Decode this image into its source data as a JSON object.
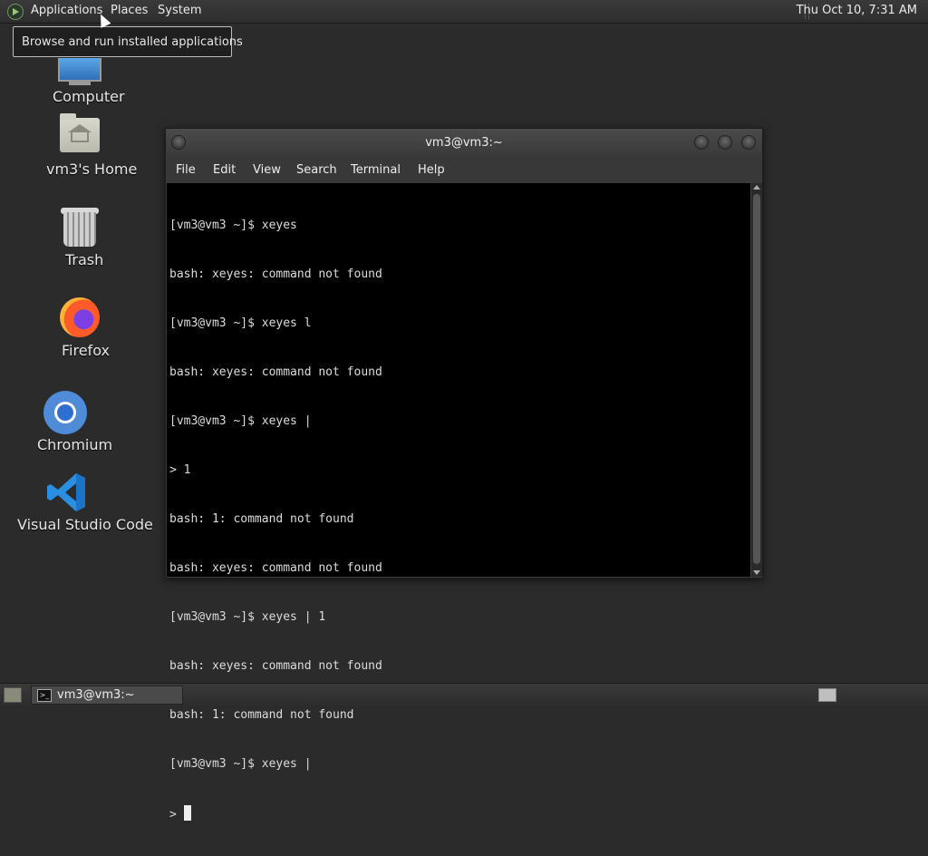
{
  "top_panel": {
    "menus": [
      "Applications",
      "Places",
      "System"
    ],
    "clock": "Thu Oct 10,  7:31 AM"
  },
  "tooltip": {
    "text": "Browse and run installed applications"
  },
  "desktop": {
    "icons": [
      {
        "label": "Computer",
        "icon": "computer-icon"
      },
      {
        "label": "vm3's Home",
        "icon": "home-folder-icon"
      },
      {
        "label": "Trash",
        "icon": "trash-icon"
      },
      {
        "label": "Firefox",
        "icon": "firefox-icon"
      },
      {
        "label": "Chromium",
        "icon": "chromium-icon"
      },
      {
        "label": "Visual Studio Code",
        "icon": "vscode-icon"
      }
    ]
  },
  "terminal": {
    "title": "vm3@vm3:~",
    "menus": [
      "File",
      "Edit",
      "View",
      "Search",
      "Terminal",
      "Help"
    ],
    "lines": [
      "[vm3@vm3 ~]$ xeyes",
      "bash: xeyes: command not found",
      "[vm3@vm3 ~]$ xeyes l",
      "bash: xeyes: command not found",
      "[vm3@vm3 ~]$ xeyes |",
      "> 1",
      "bash: 1: command not found",
      "bash: xeyes: command not found",
      "[vm3@vm3 ~]$ xeyes | 1",
      "bash: xeyes: command not found",
      "bash: 1: command not found",
      "[vm3@vm3 ~]$ xeyes |"
    ],
    "prompt": "> "
  },
  "bottom_panel": {
    "task_label": "vm3@vm3:~"
  }
}
